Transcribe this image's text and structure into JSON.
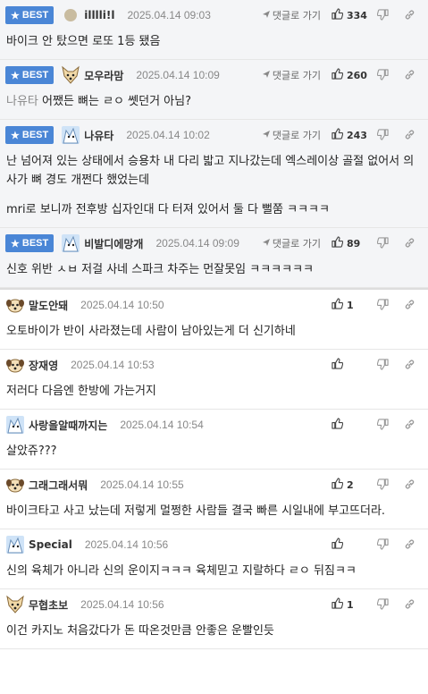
{
  "comments": [
    {
      "best": true,
      "badge": "BEST",
      "avatar": "circle",
      "nick": "illlli!l",
      "date": "2025.04.14 09:03",
      "reply": "댓글로 가기",
      "likes": "334",
      "quote": "",
      "text": [
        "바이크 안 탔으면 로또 1등 됐음"
      ]
    },
    {
      "best": true,
      "badge": "BEST",
      "avatar": "fox",
      "nick": "모우라맘",
      "date": "2025.04.14 10:09",
      "reply": "댓글로 가기",
      "likes": "260",
      "quote": "나유타",
      "text": [
        "어쨌든 뼈는 ㄹㅇ 쎗던거 아님?"
      ]
    },
    {
      "best": true,
      "badge": "BEST",
      "avatar": "blue",
      "nick": "나유타",
      "date": "2025.04.14 10:02",
      "reply": "댓글로 가기",
      "likes": "243",
      "quote": "",
      "text": [
        "난 넘어져 있는 상태에서 승용차 내 다리 밟고 지나갔는데 엑스레이상 골절 없어서 의사가 뼈 경도 개쩐다 했었는데",
        "mri로 보니까 전후방 십자인대 다 터져 있어서 둘 다 뻘쭘 ㅋㅋㅋㅋ"
      ]
    },
    {
      "best": true,
      "badge": "BEST",
      "avatar": "blue",
      "nick": "비발디에망개",
      "date": "2025.04.14 09:09",
      "reply": "댓글로 가기",
      "likes": "89",
      "quote": "",
      "text": [
        "신호 위반 ㅅㅂ 저걸 사네 스파크 차주는 먼잘못임 ㅋㅋㅋㅋㅋㅋ"
      ]
    },
    {
      "best": false,
      "badge": "",
      "avatar": "dog",
      "nick": "말도안돼",
      "date": "2025.04.14 10:50",
      "reply": "",
      "likes": "1",
      "quote": "",
      "text": [
        "오토바이가 반이 사라졌는데 사람이 남아있는게 더 신기하네"
      ]
    },
    {
      "best": false,
      "badge": "",
      "avatar": "dog",
      "nick": "장재영",
      "date": "2025.04.14 10:53",
      "reply": "",
      "likes": "",
      "quote": "",
      "text": [
        "저러다 다음엔 한방에 가는거지"
      ]
    },
    {
      "best": false,
      "badge": "",
      "avatar": "blue",
      "nick": "사랑을알때까지는",
      "date": "2025.04.14 10:54",
      "reply": "",
      "likes": "",
      "quote": "",
      "text": [
        "살았쥬???"
      ]
    },
    {
      "best": false,
      "badge": "",
      "avatar": "dog",
      "nick": "그래그래서뭐",
      "date": "2025.04.14 10:55",
      "reply": "",
      "likes": "2",
      "quote": "",
      "text": [
        "바이크타고 사고 났는데 저렇게 멀쩡한 사람들 결국 빠른 시일내에 부고뜨더라."
      ]
    },
    {
      "best": false,
      "badge": "",
      "avatar": "blue",
      "nick": "Special",
      "date": "2025.04.14 10:56",
      "reply": "",
      "likes": "",
      "quote": "",
      "text": [
        "신의 육체가 아니라 신의 운이지ㅋㅋㅋ 육체믿고 지랄하다 ㄹㅇ 뒤짐ㅋㅋ"
      ]
    },
    {
      "best": false,
      "badge": "",
      "avatar": "fox",
      "nick": "무협초보",
      "date": "2025.04.14 10:56",
      "reply": "",
      "likes": "1",
      "quote": "",
      "text": [
        "이건 카지노 처음갔다가 돈 따온것만큼 안좋은 운빨인듯"
      ]
    }
  ],
  "icons": {
    "badge": "star-icon",
    "reply": "arrow-icon",
    "like": "thumbs-up-icon",
    "dislike": "thumbs-down-icon",
    "link": "link-icon"
  },
  "colors": {
    "best_badge": "#4a86d6",
    "best_bg": "#f4f5f7"
  }
}
